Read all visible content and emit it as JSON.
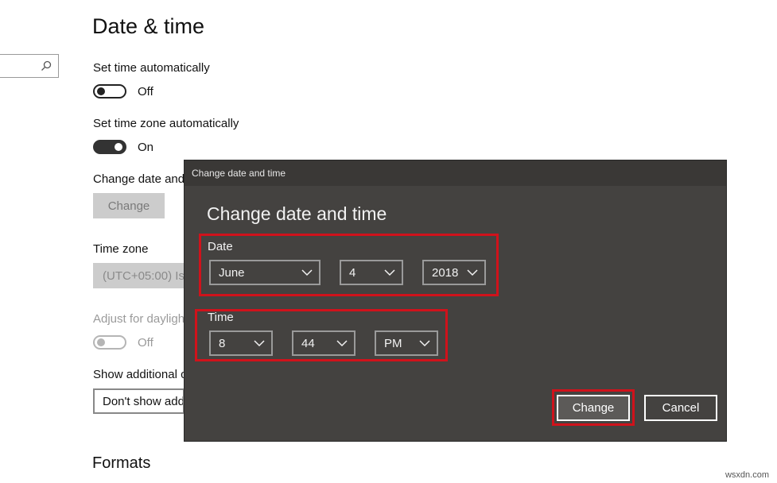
{
  "page": {
    "title": "Date & time"
  },
  "settings": {
    "set_time_auto": {
      "label": "Set time automatically",
      "state": "Off"
    },
    "set_tz_auto": {
      "label": "Set time zone automatically",
      "state": "On"
    },
    "change_date": {
      "label": "Change date and",
      "button": "Change"
    },
    "time_zone": {
      "label": "Time zone",
      "value": "(UTC+05:00) Isla"
    },
    "daylight": {
      "label": "Adjust for daylight",
      "state": "Off"
    },
    "additional": {
      "label": "Show additional c",
      "value": "Don't show add"
    },
    "formats": {
      "title": "Formats"
    }
  },
  "dialog": {
    "titlebar": "Change date and time",
    "heading": "Change date and time",
    "date_label": "Date",
    "month": "June",
    "day": "4",
    "year": "2018",
    "time_label": "Time",
    "hour": "8",
    "minute": "44",
    "ampm": "PM",
    "change_button": "Change",
    "cancel_button": "Cancel"
  },
  "watermark": "wsxdn.com",
  "icons": {
    "search": "search-icon",
    "chevron": "chevron-down-icon"
  },
  "colors": {
    "highlight": "#d0121b",
    "dialog_bg": "#444240"
  }
}
